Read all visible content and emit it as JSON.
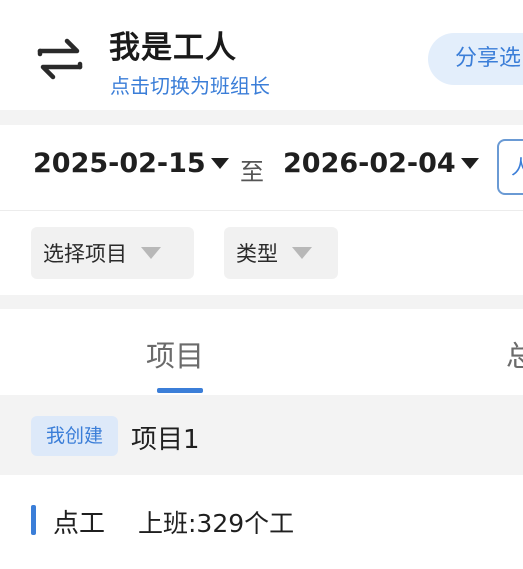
{
  "header": {
    "title": "我是工人",
    "switch_link": "点击切换为班组长",
    "share_label": "分享选"
  },
  "filters": {
    "start_date": "2025-02-15",
    "to_label": "至",
    "end_date": "2026-02-04",
    "side_box_label": "人",
    "project_select": "选择项目",
    "type_select": "类型"
  },
  "tabs": [
    {
      "label": "项目",
      "active": true
    },
    {
      "label": "总",
      "active": false
    }
  ],
  "project": {
    "badge": "我创建",
    "name": "项目1"
  },
  "summary": {
    "label": "点工",
    "value": "上班:329个工"
  },
  "colors": {
    "accent": "#3b7ed8",
    "badge_bg": "#dde9f9",
    "section_bg": "#f3f3f3"
  },
  "icons": {
    "switch": "switch-arrows-icon",
    "dropdown": "triangle-down-icon"
  }
}
